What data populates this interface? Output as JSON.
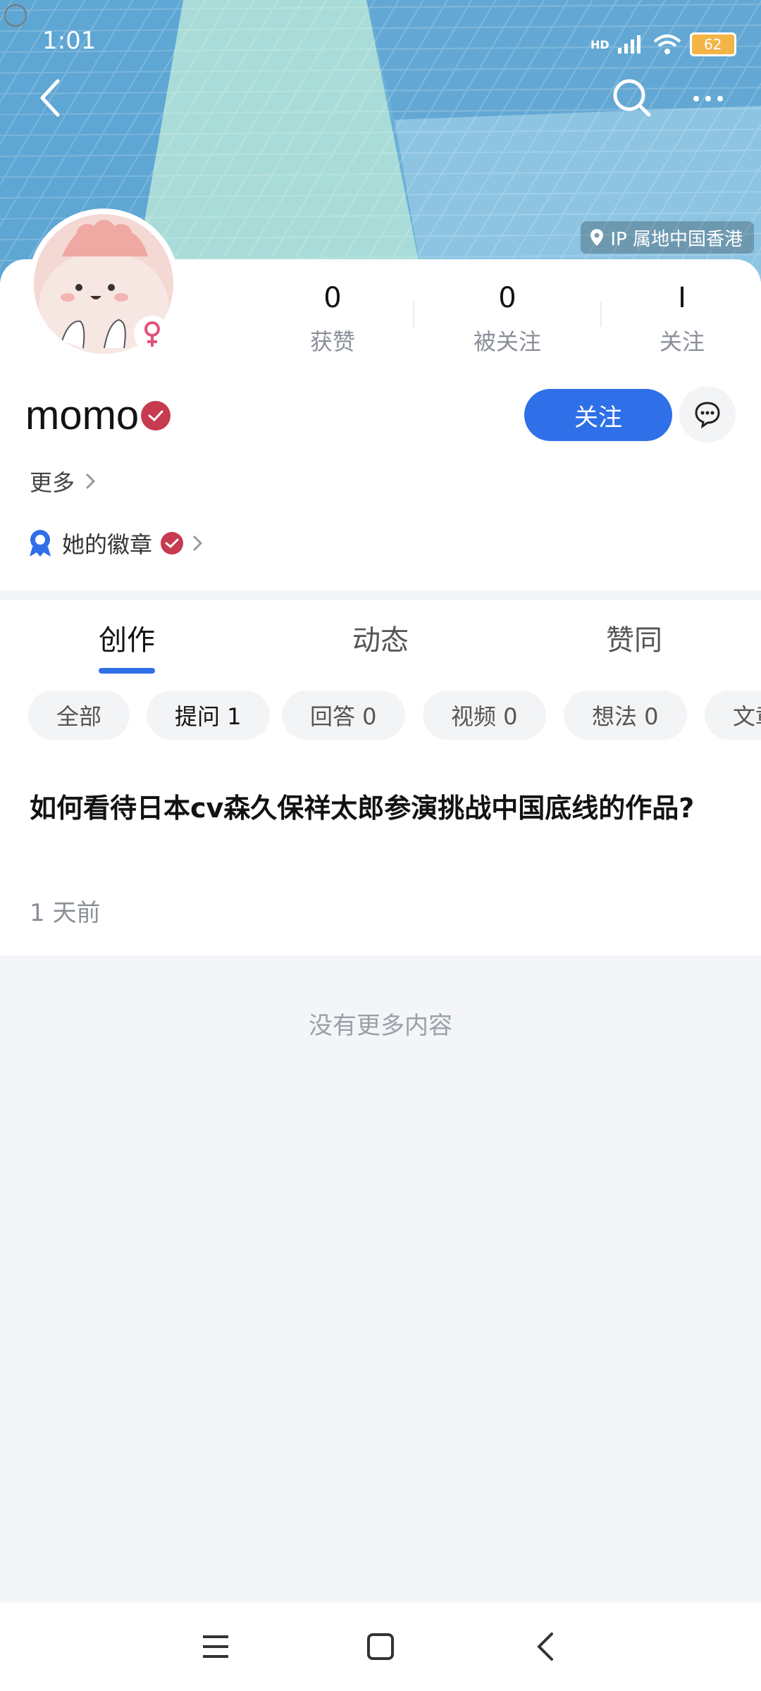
{
  "status_bar": {
    "time": "1:01",
    "network": "HD",
    "battery": "62"
  },
  "header": {
    "ip_location": "IP 属地中国香港"
  },
  "profile": {
    "name": "momo",
    "stats": [
      {
        "value": "0",
        "label": "获赞"
      },
      {
        "value": "0",
        "label": "被关注"
      },
      {
        "value": "I",
        "label": "关注"
      }
    ],
    "follow_label": "关注",
    "more_label": "更多",
    "badge_label": "她的徽章"
  },
  "tabs": [
    {
      "label": "创作",
      "active": true
    },
    {
      "label": "动态",
      "active": false
    },
    {
      "label": "赞同",
      "active": false
    }
  ],
  "chips": [
    {
      "label": "全部",
      "active": false
    },
    {
      "label": "提问 1",
      "active": true
    },
    {
      "label": "回答 0",
      "active": false
    },
    {
      "label": "视频 0",
      "active": false
    },
    {
      "label": "想法 0",
      "active": false
    },
    {
      "label": "文章",
      "active": false
    }
  ],
  "post": {
    "title": "如何看待日本cv森久保祥太郎参演挑战中国底线的作品?",
    "time": "1 天前"
  },
  "no_more_text": "没有更多内容",
  "colors": {
    "accent": "#2f6fe8",
    "verify_red": "#c63b4f",
    "banner_blue": "#6aaed5"
  }
}
